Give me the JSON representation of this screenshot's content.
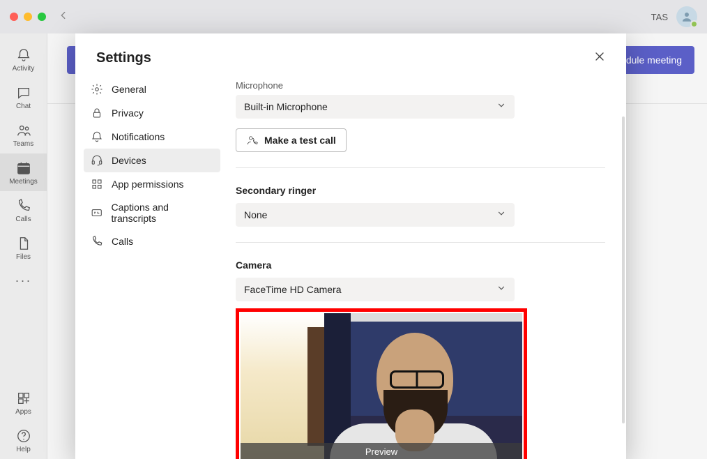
{
  "titlebar": {
    "user_initials": "TAS"
  },
  "behind": {
    "schedule_label": "dule meeting"
  },
  "rail": {
    "items": [
      {
        "label": "Activity"
      },
      {
        "label": "Chat"
      },
      {
        "label": "Teams"
      },
      {
        "label": "Meetings"
      },
      {
        "label": "Calls"
      },
      {
        "label": "Files"
      }
    ],
    "apps_label": "Apps",
    "help_label": "Help"
  },
  "modal": {
    "title": "Settings",
    "nav": {
      "general": "General",
      "privacy": "Privacy",
      "notifications": "Notifications",
      "devices": "Devices",
      "app_permissions": "App permissions",
      "captions": "Captions and transcripts",
      "calls": "Calls"
    },
    "devices": {
      "microphone_label": "Microphone",
      "microphone_value": "Built-in Microphone",
      "test_call_label": "Make a test call",
      "secondary_ringer_heading": "Secondary ringer",
      "secondary_ringer_value": "None",
      "camera_heading": "Camera",
      "camera_value": "FaceTime HD Camera",
      "preview_label": "Preview"
    }
  }
}
